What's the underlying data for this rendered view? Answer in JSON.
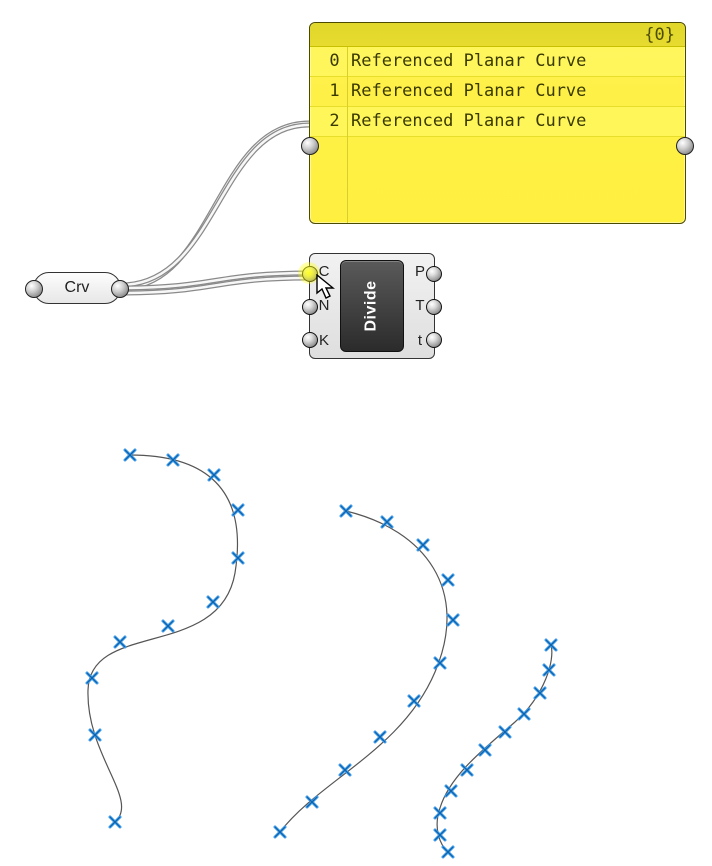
{
  "panel": {
    "header": "{0}",
    "rows": [
      {
        "index": "0",
        "text": "Referenced Planar Curve"
      },
      {
        "index": "1",
        "text": "Referenced Planar Curve"
      },
      {
        "index": "2",
        "text": "Referenced Planar Curve"
      }
    ]
  },
  "crvParam": {
    "label": "Crv"
  },
  "component": {
    "name": "Divide",
    "inputs": [
      "C",
      "N",
      "K"
    ],
    "outputs": [
      "P",
      "T",
      "t"
    ]
  },
  "chart_data": {
    "type": "diagram",
    "note": "Grasshopper canvas: a Crv parameter wired into a panel and into the C input of a Divide Curve component. Below, Rhino viewport shows 3 planar curves each divided into 11 points (10 segments).",
    "curves": 3,
    "points_per_curve": 11,
    "divisions": 10
  }
}
